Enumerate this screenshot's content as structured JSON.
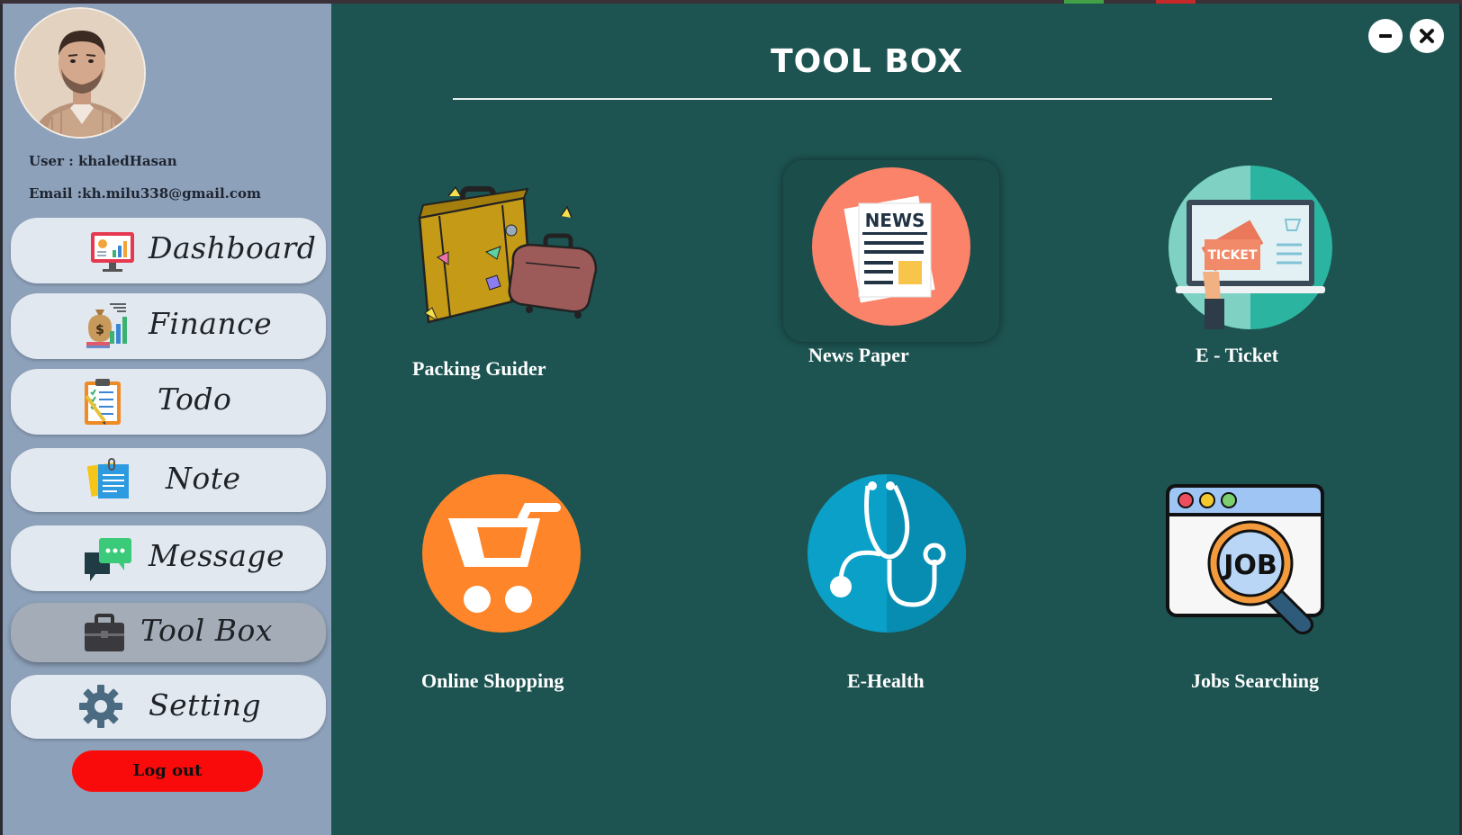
{
  "user": {
    "name_line": "User : khaledHasan",
    "email_line": "Email :kh.milu338@gmail.com"
  },
  "nav": [
    {
      "label": "Dashboard",
      "icon": "dashboard-monitor-icon"
    },
    {
      "label": "Finance",
      "icon": "finance-moneybag-icon"
    },
    {
      "label": "Todo",
      "icon": "todo-clipboard-icon"
    },
    {
      "label": "Note",
      "icon": "note-sticky-icon"
    },
    {
      "label": "Message",
      "icon": "message-chat-icon"
    },
    {
      "label": "Tool Box",
      "icon": "toolbox-briefcase-icon",
      "active": true
    },
    {
      "label": "Setting",
      "icon": "setting-gear-icon"
    }
  ],
  "logout_label": "Log out",
  "main": {
    "title": "TOOL BOX",
    "tools": [
      {
        "label": "Packing Guider",
        "icon": "luggage-icon"
      },
      {
        "label": "News Paper",
        "icon": "newspaper-icon"
      },
      {
        "label": "E - Ticket",
        "icon": "e-ticket-icon"
      },
      {
        "label": "Online Shopping",
        "icon": "shopping-cart-icon"
      },
      {
        "label": "E-Health",
        "icon": "stethoscope-icon"
      },
      {
        "label": "Jobs Searching",
        "icon": "job-search-icon"
      }
    ]
  },
  "colors": {
    "sidebar": "#8da1ba",
    "main_bg": "#1d5452",
    "nav_pill": "#e2e8ef",
    "nav_active": "#a4adb7",
    "logout": "#fa0b0b"
  }
}
